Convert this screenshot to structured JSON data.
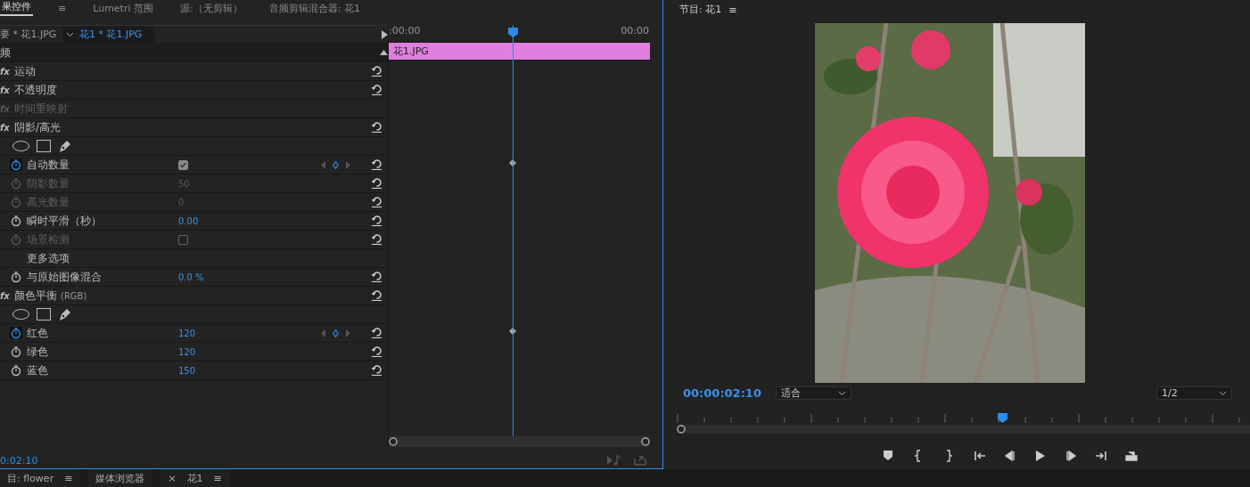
{
  "effect_controls": {
    "tabs": [
      {
        "label": "果控件",
        "selected": true
      },
      {
        "label": "≡",
        "selected": false
      },
      {
        "label": "Lumetri 范围",
        "selected": false
      },
      {
        "label": "源:（无剪辑）",
        "selected": false
      },
      {
        "label": "音频剪辑混合器: 花1",
        "selected": false
      }
    ],
    "master_clip": "要 * 花1.JPG",
    "sequence_clip": "花1 * 花1.JPG",
    "section": "频",
    "rows": [
      {
        "kind": "effect",
        "badge": "fx",
        "label": "运动",
        "disabled": false,
        "reset": true
      },
      {
        "kind": "effect",
        "badge": "fx",
        "label": "不透明度",
        "disabled": false,
        "reset": true
      },
      {
        "kind": "effect",
        "badge": "fx",
        "label": "时间重映射",
        "disabled": true,
        "reset": false
      },
      {
        "kind": "effect",
        "badge": "fx",
        "label": "阴影/高光",
        "disabled": false,
        "reset": true
      },
      {
        "kind": "masks"
      },
      {
        "kind": "checkbox_param",
        "label": "自动数量",
        "animated": true,
        "disabled": false,
        "checked": true,
        "keyframe": true,
        "reset": true
      },
      {
        "kind": "number_param",
        "label": "阴影数量",
        "animated": false,
        "disabled": true,
        "value": "50",
        "keyframe": false,
        "reset": true
      },
      {
        "kind": "number_param",
        "label": "高光数量",
        "animated": false,
        "disabled": true,
        "value": "0",
        "keyframe": false,
        "reset": true
      },
      {
        "kind": "number_param",
        "label": "瞬时平滑（秒）",
        "animated": false,
        "disabled": false,
        "value": "0.00",
        "keyframe": false,
        "reset": true
      },
      {
        "kind": "checkbox_param",
        "label": "场景检测",
        "animated": false,
        "disabled": true,
        "checked": false,
        "keyframe": false,
        "reset": true
      },
      {
        "kind": "label",
        "label": "更多选项"
      },
      {
        "kind": "number_param",
        "label": "与原始图像混合",
        "animated": false,
        "disabled": false,
        "value": "0.0 %",
        "keyframe": false,
        "reset": true
      },
      {
        "kind": "effect",
        "badge": "fx",
        "label": "颜色平衡",
        "suffix": "(RGB)",
        "disabled": false,
        "reset": true
      },
      {
        "kind": "masks"
      },
      {
        "kind": "number_param",
        "label": "红色",
        "animated": true,
        "disabled": false,
        "value": "120",
        "keyframe": true,
        "reset": true
      },
      {
        "kind": "number_param",
        "label": "绿色",
        "animated": false,
        "disabled": false,
        "value": "120",
        "keyframe": false,
        "reset": true
      },
      {
        "kind": "number_param",
        "label": "蓝色",
        "animated": false,
        "disabled": false,
        "value": "150",
        "keyframe": false,
        "reset": true
      }
    ],
    "timeline": {
      "start": ":00:00",
      "end": "00:00",
      "clip": "花1.JPG",
      "playhead": {
        "level": 0.476
      }
    },
    "timecode": "0:02:10"
  },
  "program_monitor": {
    "title": "节目: 花1",
    "menu": "≡",
    "timecode": "00:00:02:10",
    "zoom": "适合",
    "resolution": "1/2",
    "playhead": {
      "level": 0.56
    }
  },
  "bottom_tabs": [
    {
      "label": "目: flower",
      "menu": "≡"
    },
    {
      "label": "媒体浏览器"
    },
    {
      "close": "×",
      "label": "花1",
      "menu": "≡"
    }
  ]
}
